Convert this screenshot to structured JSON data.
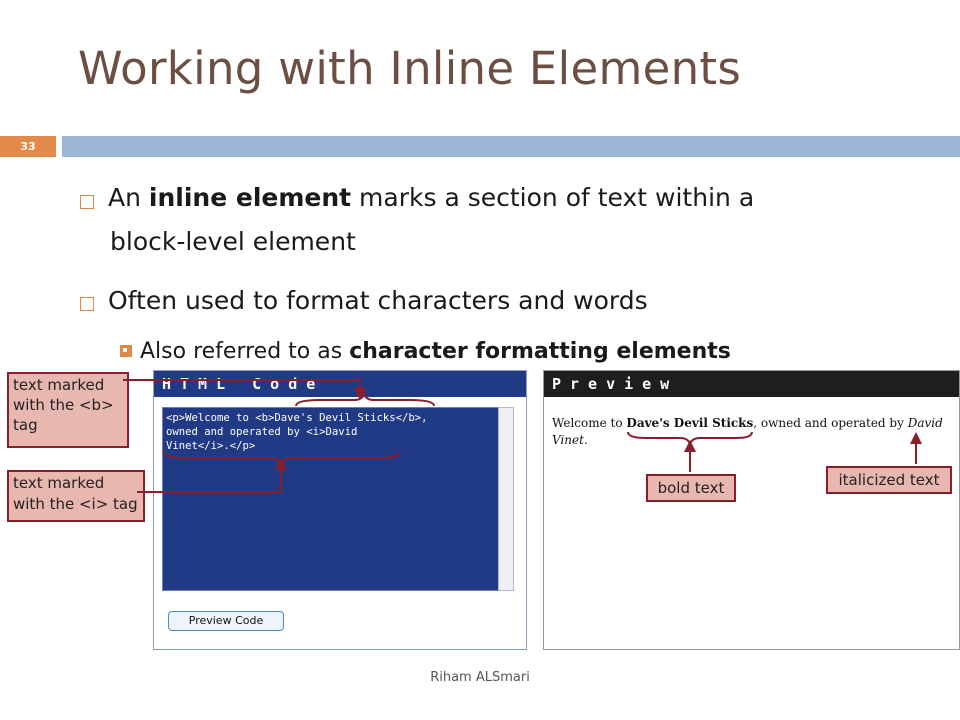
{
  "slide": {
    "title": "Working with Inline Elements",
    "number": "33",
    "footer": "Riham ALSmari"
  },
  "bullets": [
    {
      "pre": "An ",
      "bold": "inline element",
      "post_line1": " marks a section of text within a",
      "line2": "block-level element"
    },
    {
      "text": "Often used to format characters and words"
    }
  ],
  "sub_bullet": {
    "pre": "Also referred to as ",
    "bold": "character formatting elements"
  },
  "figure": {
    "code_panel": {
      "header": "HTML Code",
      "code": "<p>Welcome to <b>Dave's Devil Sticks</b>,\nowned and operated by <i>David\nVinet</i>.</p>",
      "button": "Preview Code"
    },
    "preview_panel": {
      "header": "Preview",
      "text_pre": "Welcome to ",
      "text_bold": "Dave's Devil Sticks",
      "text_mid": ", owned and operated by ",
      "text_italic": "David Vinet",
      "text_post": "."
    },
    "callouts": {
      "bold_tag": "text marked with the <b> tag",
      "italic_tag": "text marked with the <i> tag",
      "bold_text": "bold text",
      "italic_text": "italicized text"
    },
    "colors": {
      "code_bg": "#213a86",
      "callout_border": "#8b1e2b",
      "callout_fill": "#e8b7b0"
    }
  }
}
